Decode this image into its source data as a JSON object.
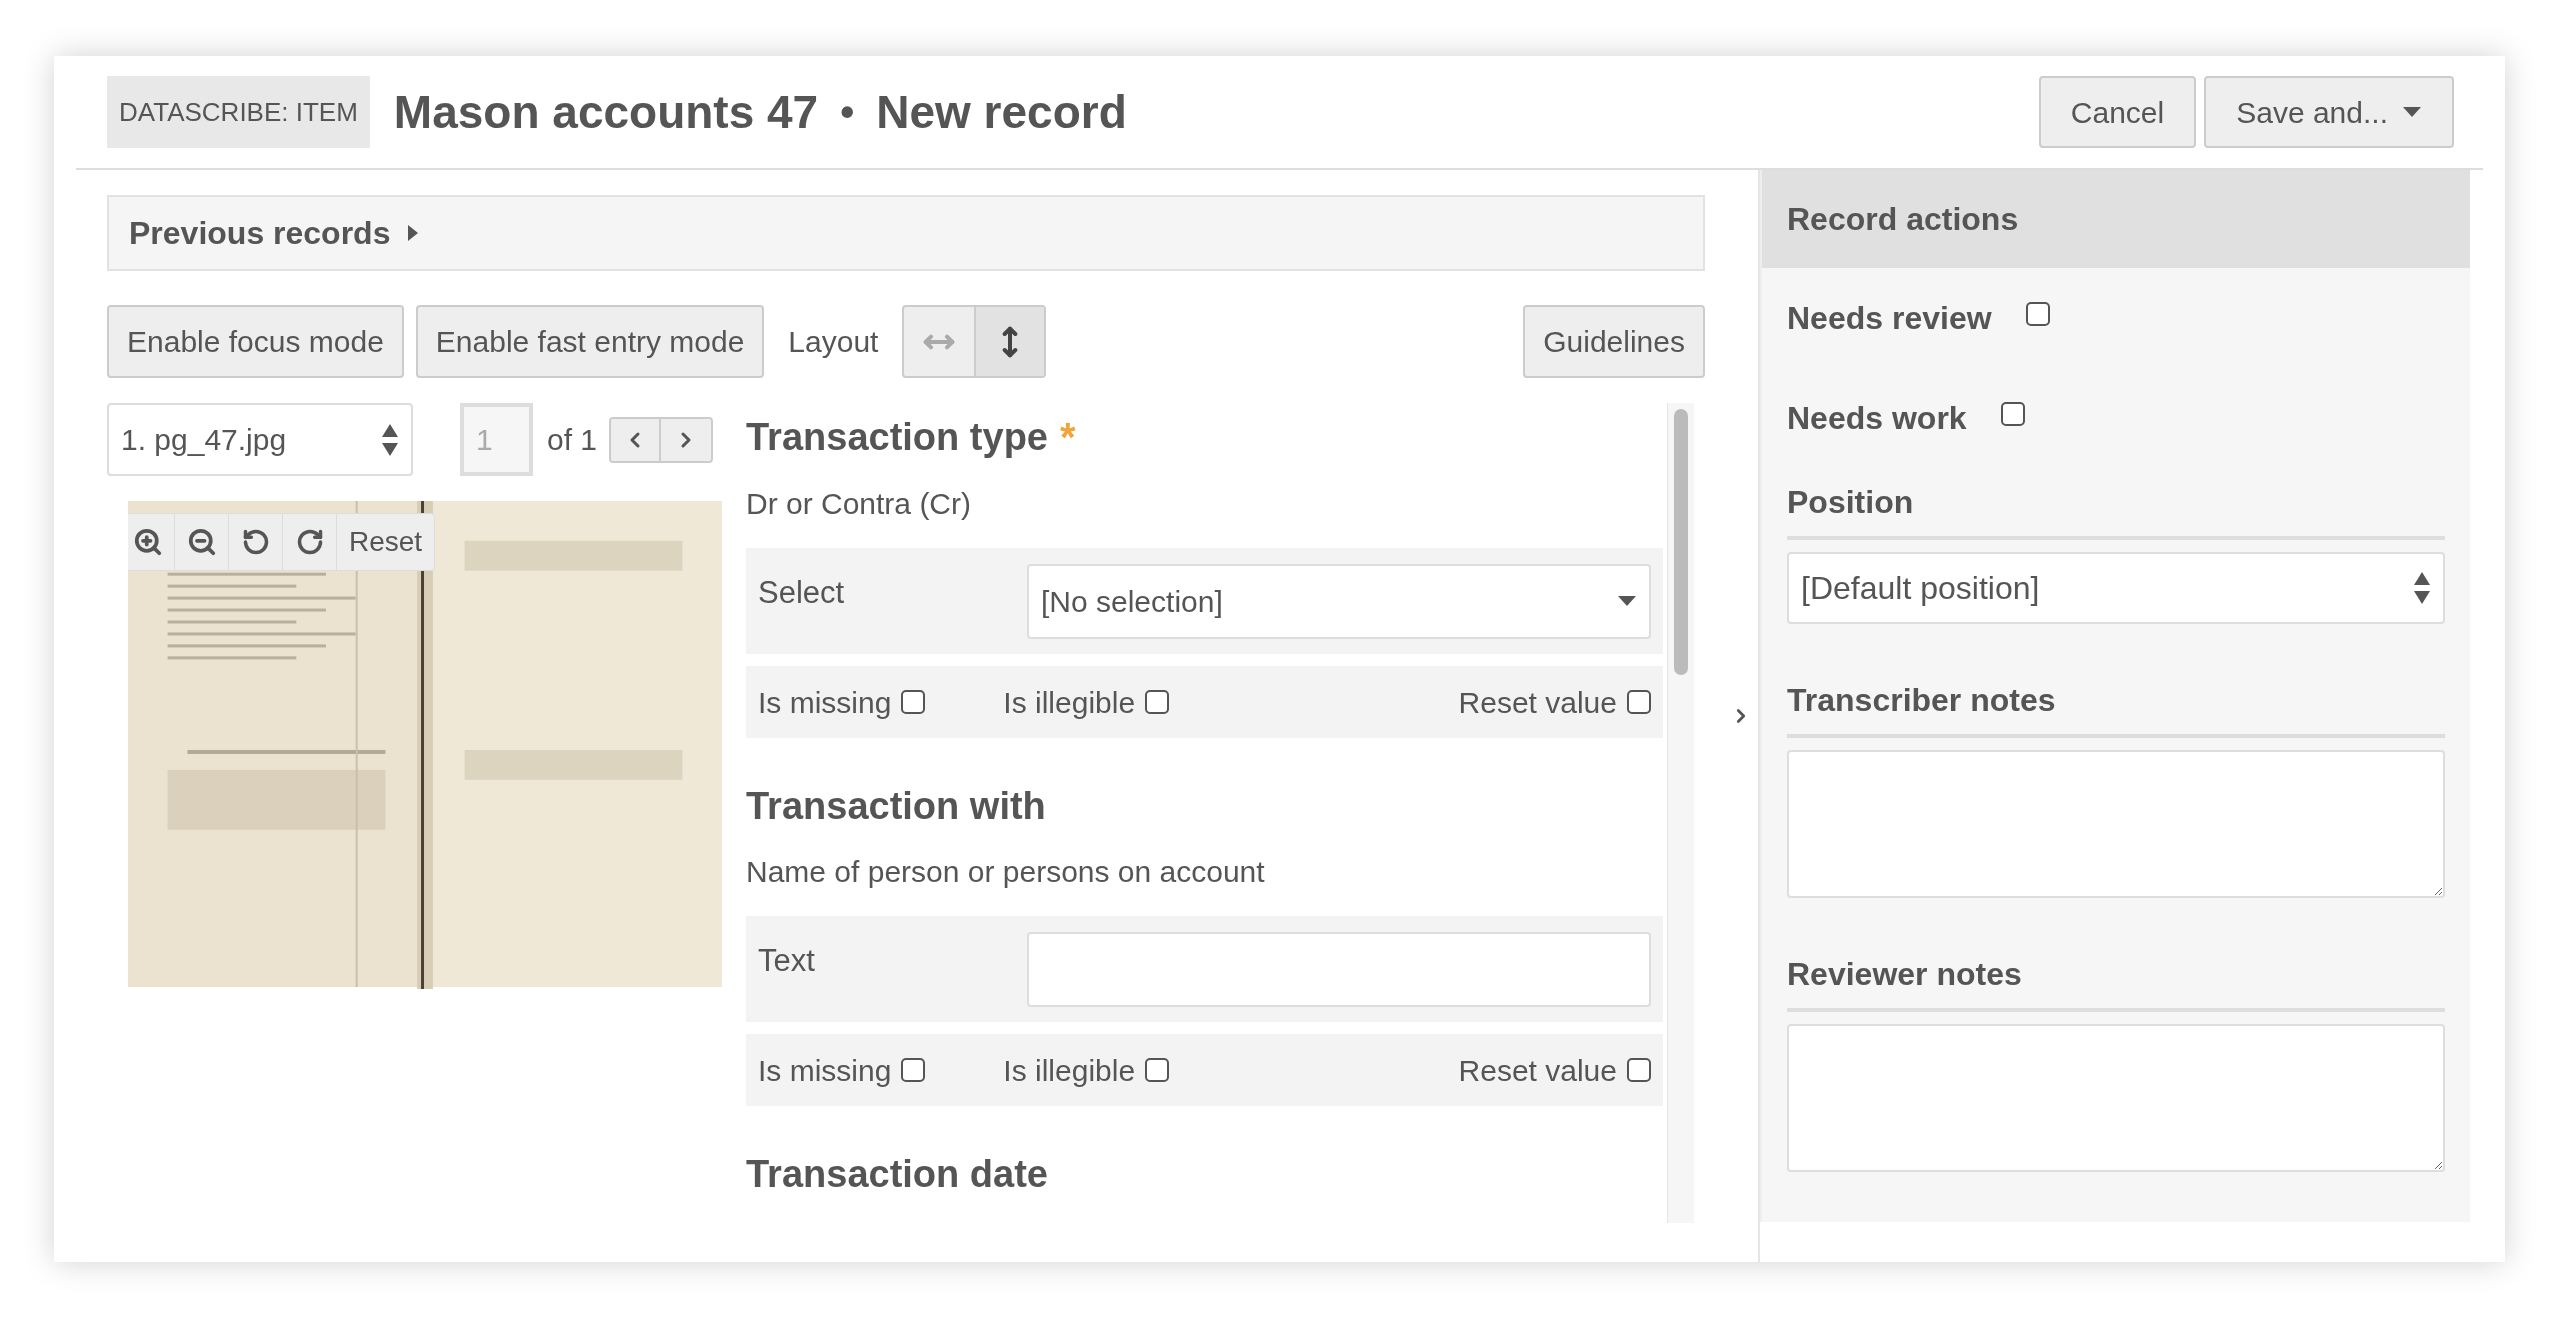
{
  "header": {
    "badge": "DATASCRIBE: ITEM",
    "title": "Mason accounts 47",
    "separator": "•",
    "subtitle": "New record",
    "buttons": [
      {
        "label": "Cancel",
        "dropdown": false
      },
      {
        "label": "Save and...",
        "dropdown": true
      }
    ]
  },
  "previous_records": {
    "label": "Previous records",
    "expanded": false
  },
  "toolbar": {
    "buttons": [
      "Enable focus mode",
      "Enable fast entry mode"
    ],
    "layout_label": "Layout",
    "layout_options": [
      {
        "kind": "horizontal",
        "selected": false
      },
      {
        "kind": "vertical",
        "selected": true
      }
    ],
    "guidelines": "Guidelines"
  },
  "media": {
    "file": "1. pg_47.jpg",
    "page": "1",
    "page_count": "of 1",
    "reset": "Reset"
  },
  "fields": [
    {
      "title": "Transaction type",
      "required_mark": "*",
      "description": "Dr or Contra (Cr)",
      "input": {
        "kind": "select",
        "label": "Select",
        "value": "[No selection]"
      },
      "flags": [
        {
          "label": "Is missing",
          "checked": false
        },
        {
          "label": "Is illegible",
          "checked": false
        },
        {
          "label": "Reset value",
          "checked": false
        }
      ]
    },
    {
      "title": "Transaction with",
      "description": "Name of person or persons on account",
      "input": {
        "kind": "text",
        "label": "Text"
      },
      "flags": [
        {
          "label": "Is missing",
          "checked": false
        },
        {
          "label": "Is illegible",
          "checked": false
        },
        {
          "label": "Reset value",
          "checked": false
        }
      ]
    },
    {
      "title": "Transaction date"
    }
  ],
  "record_actions": {
    "title": "Record actions",
    "checkboxes": [
      {
        "label": "Needs review",
        "checked": false
      },
      {
        "label": "Needs work",
        "checked": false
      }
    ],
    "position": {
      "label": "Position",
      "value": "[Default position]"
    },
    "notes": [
      {
        "label": "Transcriber notes"
      },
      {
        "label": "Reviewer notes"
      }
    ]
  }
}
